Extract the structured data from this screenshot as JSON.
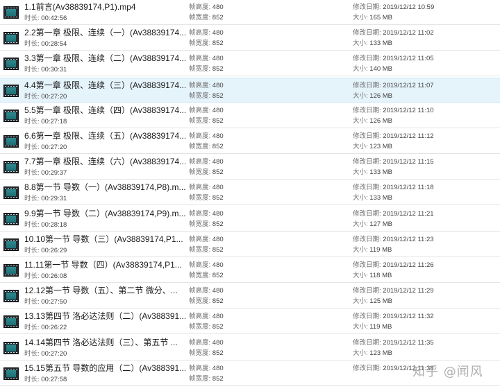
{
  "labels": {
    "duration": "时长: ",
    "frame_height": "帧高度: ",
    "frame_width": "帧宽度: ",
    "modified": "修改日期: ",
    "size": "大小: "
  },
  "files": [
    {
      "title": "1.1前言(Av38839174,P1).mp4",
      "duration": "00:42:56",
      "frame_height": "480",
      "frame_width": "852",
      "modified": "2019/12/12 10:59",
      "size": "165 MB"
    },
    {
      "title": "2.2第一章 极限、连续（一）(Av38839174...",
      "duration": "00:28:54",
      "frame_height": "480",
      "frame_width": "852",
      "modified": "2019/12/12 11:02",
      "size": "133 MB"
    },
    {
      "title": "3.3第一章 极限、连续（二）(Av38839174...",
      "duration": "00:30:31",
      "frame_height": "480",
      "frame_width": "852",
      "modified": "2019/12/12 11:05",
      "size": "140 MB"
    },
    {
      "title": "4.4第一章 极限、连续（三）(Av38839174...",
      "duration": "00:27:20",
      "frame_height": "480",
      "frame_width": "852",
      "modified": "2019/12/12 11:07",
      "size": "126 MB",
      "selected": true
    },
    {
      "title": "5.5第一章 极限、连续（四）(Av38839174...",
      "duration": "00:27:18",
      "frame_height": "480",
      "frame_width": "852",
      "modified": "2019/12/12 11:10",
      "size": "126 MB"
    },
    {
      "title": "6.6第一章 极限、连续（五）(Av38839174...",
      "duration": "00:27:20",
      "frame_height": "480",
      "frame_width": "852",
      "modified": "2019/12/12 11:12",
      "size": "123 MB"
    },
    {
      "title": "7.7第一章 极限、连续（六）(Av38839174...",
      "duration": "00:29:37",
      "frame_height": "480",
      "frame_width": "852",
      "modified": "2019/12/12 11:15",
      "size": "133 MB"
    },
    {
      "title": "8.8第一节 导数（一）(Av38839174,P8).m...",
      "duration": "00:29:31",
      "frame_height": "480",
      "frame_width": "852",
      "modified": "2019/12/12 11:18",
      "size": "133 MB"
    },
    {
      "title": "9.9第一节 导数（二）(Av38839174,P9).m...",
      "duration": "00:28:18",
      "frame_height": "480",
      "frame_width": "852",
      "modified": "2019/12/12 11:21",
      "size": "127 MB"
    },
    {
      "title": "10.10第一节 导数（三）(Av38839174,P1...",
      "duration": "00:26:29",
      "frame_height": "480",
      "frame_width": "852",
      "modified": "2019/12/12 11:23",
      "size": "119 MB"
    },
    {
      "title": "11.11第一节 导数（四）(Av38839174,P1...",
      "duration": "00:26:08",
      "frame_height": "480",
      "frame_width": "852",
      "modified": "2019/12/12 11:26",
      "size": "118 MB"
    },
    {
      "title": "12.12第一节 导数（五）、第二节 微分、...",
      "duration": "00:27:50",
      "frame_height": "480",
      "frame_width": "852",
      "modified": "2019/12/12 11:29",
      "size": "125 MB"
    },
    {
      "title": "13.13第四节 洛必达法则（二）(Av388391...",
      "duration": "00:26:22",
      "frame_height": "480",
      "frame_width": "852",
      "modified": "2019/12/12 11:32",
      "size": "119 MB"
    },
    {
      "title": "14.14第四节 洛必达法则（三）、第五节 ...",
      "duration": "00:27:20",
      "frame_height": "480",
      "frame_width": "852",
      "modified": "2019/12/12 11:35",
      "size": "123 MB"
    },
    {
      "title": "15.15第五节 导数的应用（二）(Av388391...",
      "duration": "00:27:58",
      "frame_height": "480",
      "frame_width": "852",
      "modified": "2019/12/12 11:38",
      "size": "",
      "size_hidden": true
    }
  ],
  "watermark": "知乎 @闻风",
  "icons": {
    "file": "video-file-icon"
  }
}
